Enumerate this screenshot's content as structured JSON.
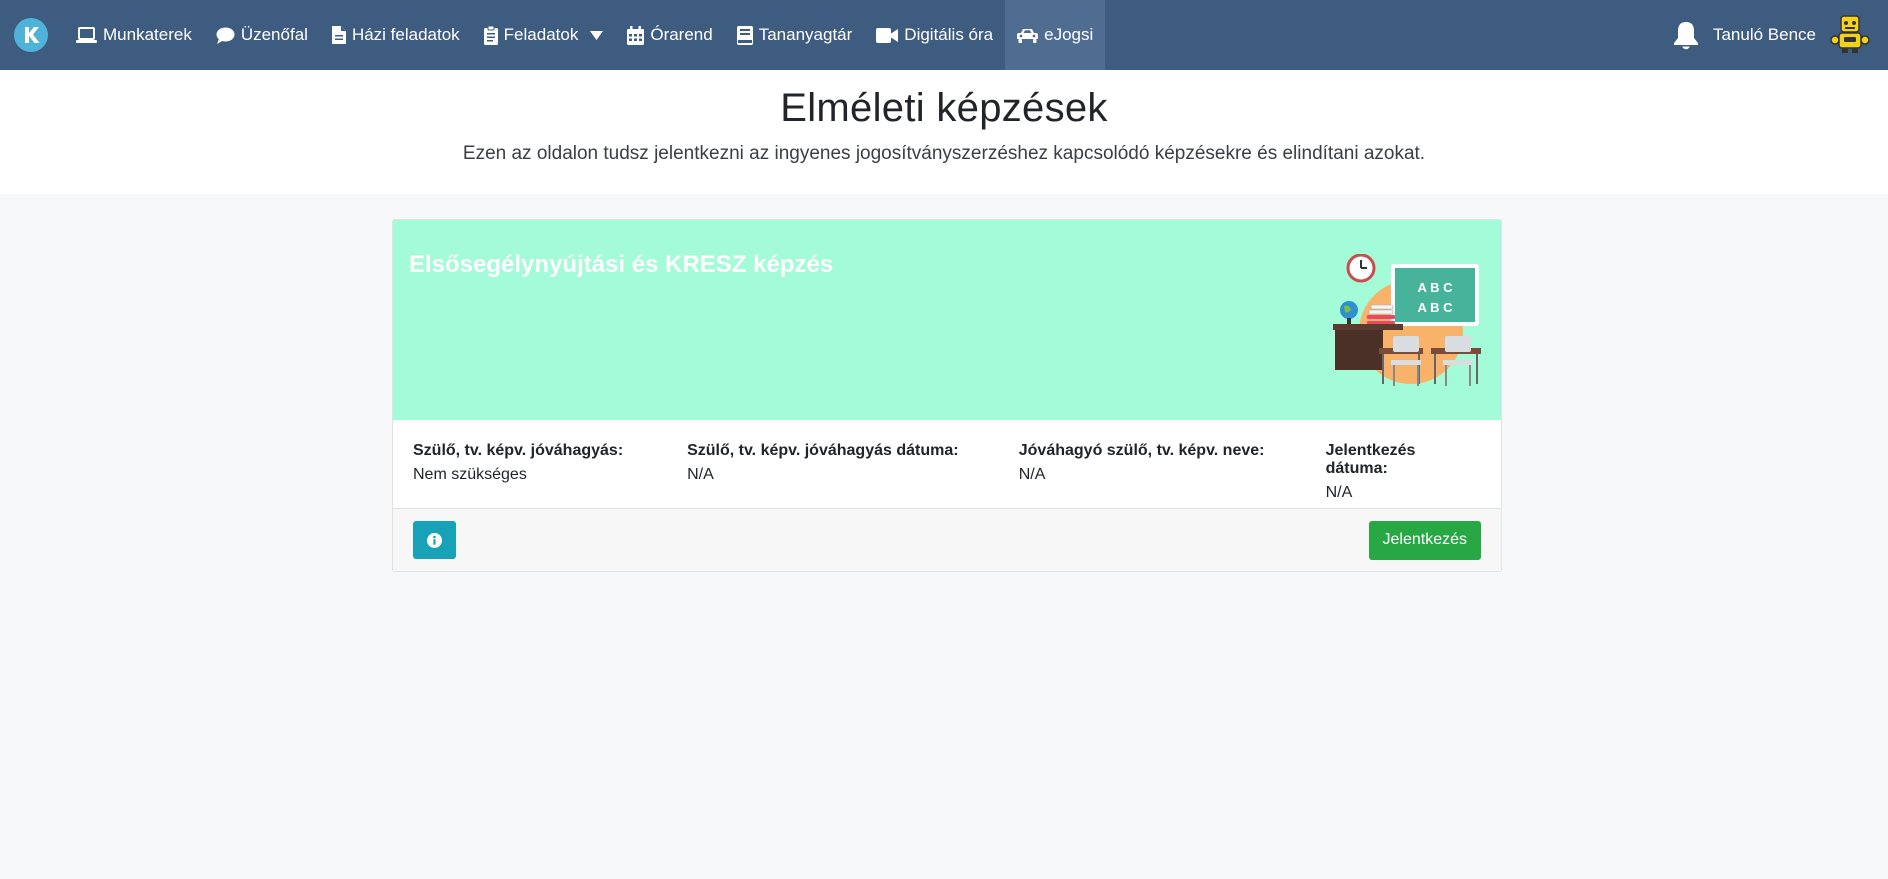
{
  "nav": {
    "items": [
      {
        "label": "Munkaterek",
        "icon": "laptop-icon"
      },
      {
        "label": "Üzenőfal",
        "icon": "comment-icon"
      },
      {
        "label": "Házi feladatok",
        "icon": "file-icon"
      },
      {
        "label": "Feladatok",
        "icon": "clipboard-icon"
      },
      {
        "label": "Órarend",
        "icon": "calendar-icon"
      },
      {
        "label": "Tananyagtár",
        "icon": "book-icon"
      },
      {
        "label": "Digitális óra",
        "icon": "video-icon"
      },
      {
        "label": "eJogsi",
        "icon": "car-icon"
      }
    ],
    "user_name": "Tanuló Bence",
    "colors": {
      "navbar": "#3e5c80",
      "active": "#4f6c91"
    }
  },
  "header": {
    "title": "Elméleti képzések",
    "lead": "Ezen az oldalon tudsz jelentkezni az ingyenes jogosítványszerzéshez kapcsolódó képzésekre és elindítani azokat."
  },
  "card": {
    "title": "Elsősegélynyújtási és KRESZ képzés",
    "board_lines": [
      "A B C",
      "A B C"
    ],
    "fields": [
      {
        "label": "Szülő, tv. képv. jóváhagyás:",
        "value": "Nem szükséges"
      },
      {
        "label": "Szülő, tv. képv. jóváhagyás dátuma:",
        "value": "N/A"
      },
      {
        "label": "Jóváhagyó szülő, tv. képv. neve:",
        "value": "N/A"
      },
      {
        "label": "Jelentkezés dátuma:",
        "value": "N/A"
      }
    ],
    "register_label": "Jelentkezés",
    "colors": {
      "banner": "#a3fcd7",
      "info_button": "#17a2b8",
      "register_button": "#28a745"
    }
  }
}
